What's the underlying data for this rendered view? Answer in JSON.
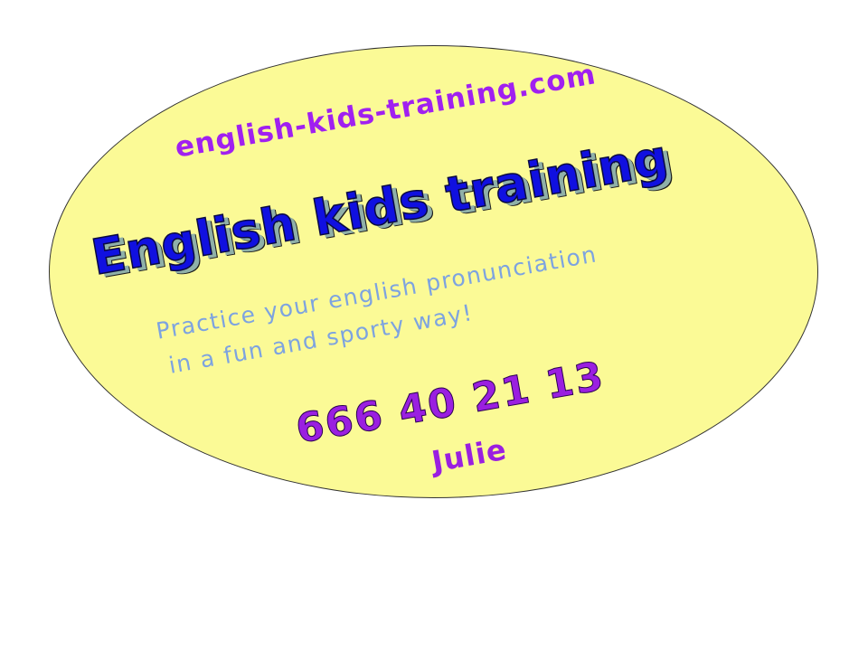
{
  "sticker": {
    "website": "english-kids-training.com",
    "brand": "English kids training",
    "tagline_line1": "Practice your english pronunciation",
    "tagline_line2": "in a fun and sporty way!",
    "phone": "666 40 21 13",
    "contact_name": "Julie"
  },
  "colors": {
    "background": "#ffffff",
    "oval_fill": "#fbfa96",
    "oval_border": "#333333",
    "website": "#a020f0",
    "brand": "#1010e0",
    "brand_shadow": "#8fb0a8",
    "tagline": "#7da3e0",
    "phone": "#9a1fe0",
    "name": "#9a1fe0"
  }
}
